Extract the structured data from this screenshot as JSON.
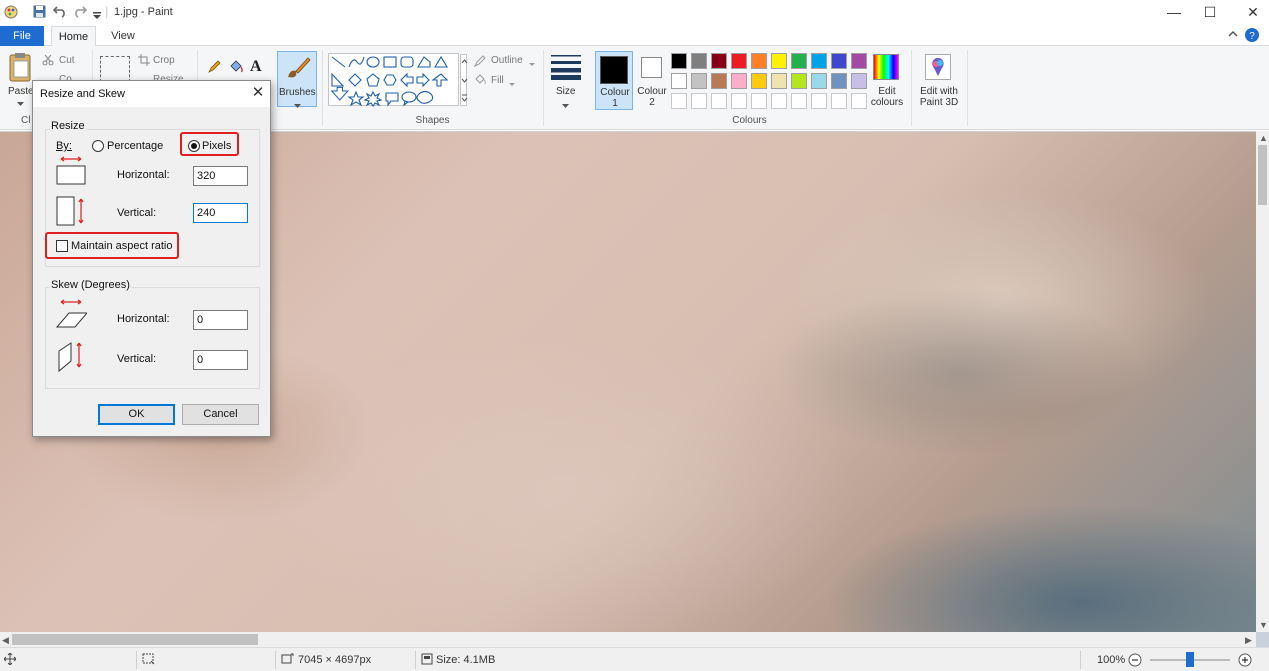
{
  "window": {
    "title": "1.jpg - Paint",
    "minimize": "—",
    "maximize": "☐",
    "close": "✕"
  },
  "quick_access": {
    "icons": [
      "paint-app-icon",
      "save-icon",
      "undo-icon",
      "redo-icon",
      "customize-icon"
    ]
  },
  "tabs": [
    {
      "label": "File"
    },
    {
      "label": "Home"
    },
    {
      "label": "View"
    }
  ],
  "ribbon": {
    "clipboard": {
      "paste_label": "Paste",
      "cut_label": "Cut",
      "copy_partial": "Co",
      "group_partial": "Cl"
    },
    "image": {
      "crop_label": "Crop",
      "resize_partial": "Resize"
    },
    "brushes_label": "Brushes",
    "shapes": {
      "group_label": "Shapes",
      "outline_label": "Outline",
      "fill_label": "Fill"
    },
    "size_label": "Size",
    "colour1_label": "Colour 1",
    "colour2_label": "Colour 2",
    "colours_group_label": "Colours",
    "edit_colours_label": "Edit colours",
    "edit_paint3d_label": "Edit with Paint 3D",
    "palette_row1": [
      "#000000",
      "#7f7f7f",
      "#880015",
      "#ed1c24",
      "#ff7f27",
      "#fff200",
      "#22b14c",
      "#00a2e8",
      "#3f48cc",
      "#a349a4"
    ],
    "palette_row2": [
      "#ffffff",
      "#c3c3c3",
      "#b97a57",
      "#ffaec9",
      "#ffc90e",
      "#efe4b0",
      "#b5e61d",
      "#99d9ea",
      "#7092be",
      "#c8bfe7"
    ],
    "colour1": "#000000",
    "colour2": "#ffffff"
  },
  "dialog": {
    "title": "Resize and Skew",
    "resize_legend": "Resize",
    "by_label": "By:",
    "percentage_label": "Percentage",
    "pixels_label": "Pixels",
    "selected_unit": "Pixels",
    "horizontal_label": "Horizontal:",
    "vertical_label": "Vertical:",
    "resize_horizontal_value": "320",
    "resize_vertical_value": "240",
    "maintain_aspect_label": "Maintain aspect ratio",
    "maintain_aspect_checked": false,
    "skew_legend": "Skew (Degrees)",
    "skew_horizontal_label": "Horizontal:",
    "skew_vertical_label": "Vertical:",
    "skew_horizontal_value": "0",
    "skew_vertical_value": "0",
    "ok_label": "OK",
    "cancel_label": "Cancel",
    "highlight_color": "#e02020"
  },
  "status": {
    "dimensions": "7045 × 4697px",
    "size": "Size: 4.1MB",
    "zoom": "100%"
  }
}
